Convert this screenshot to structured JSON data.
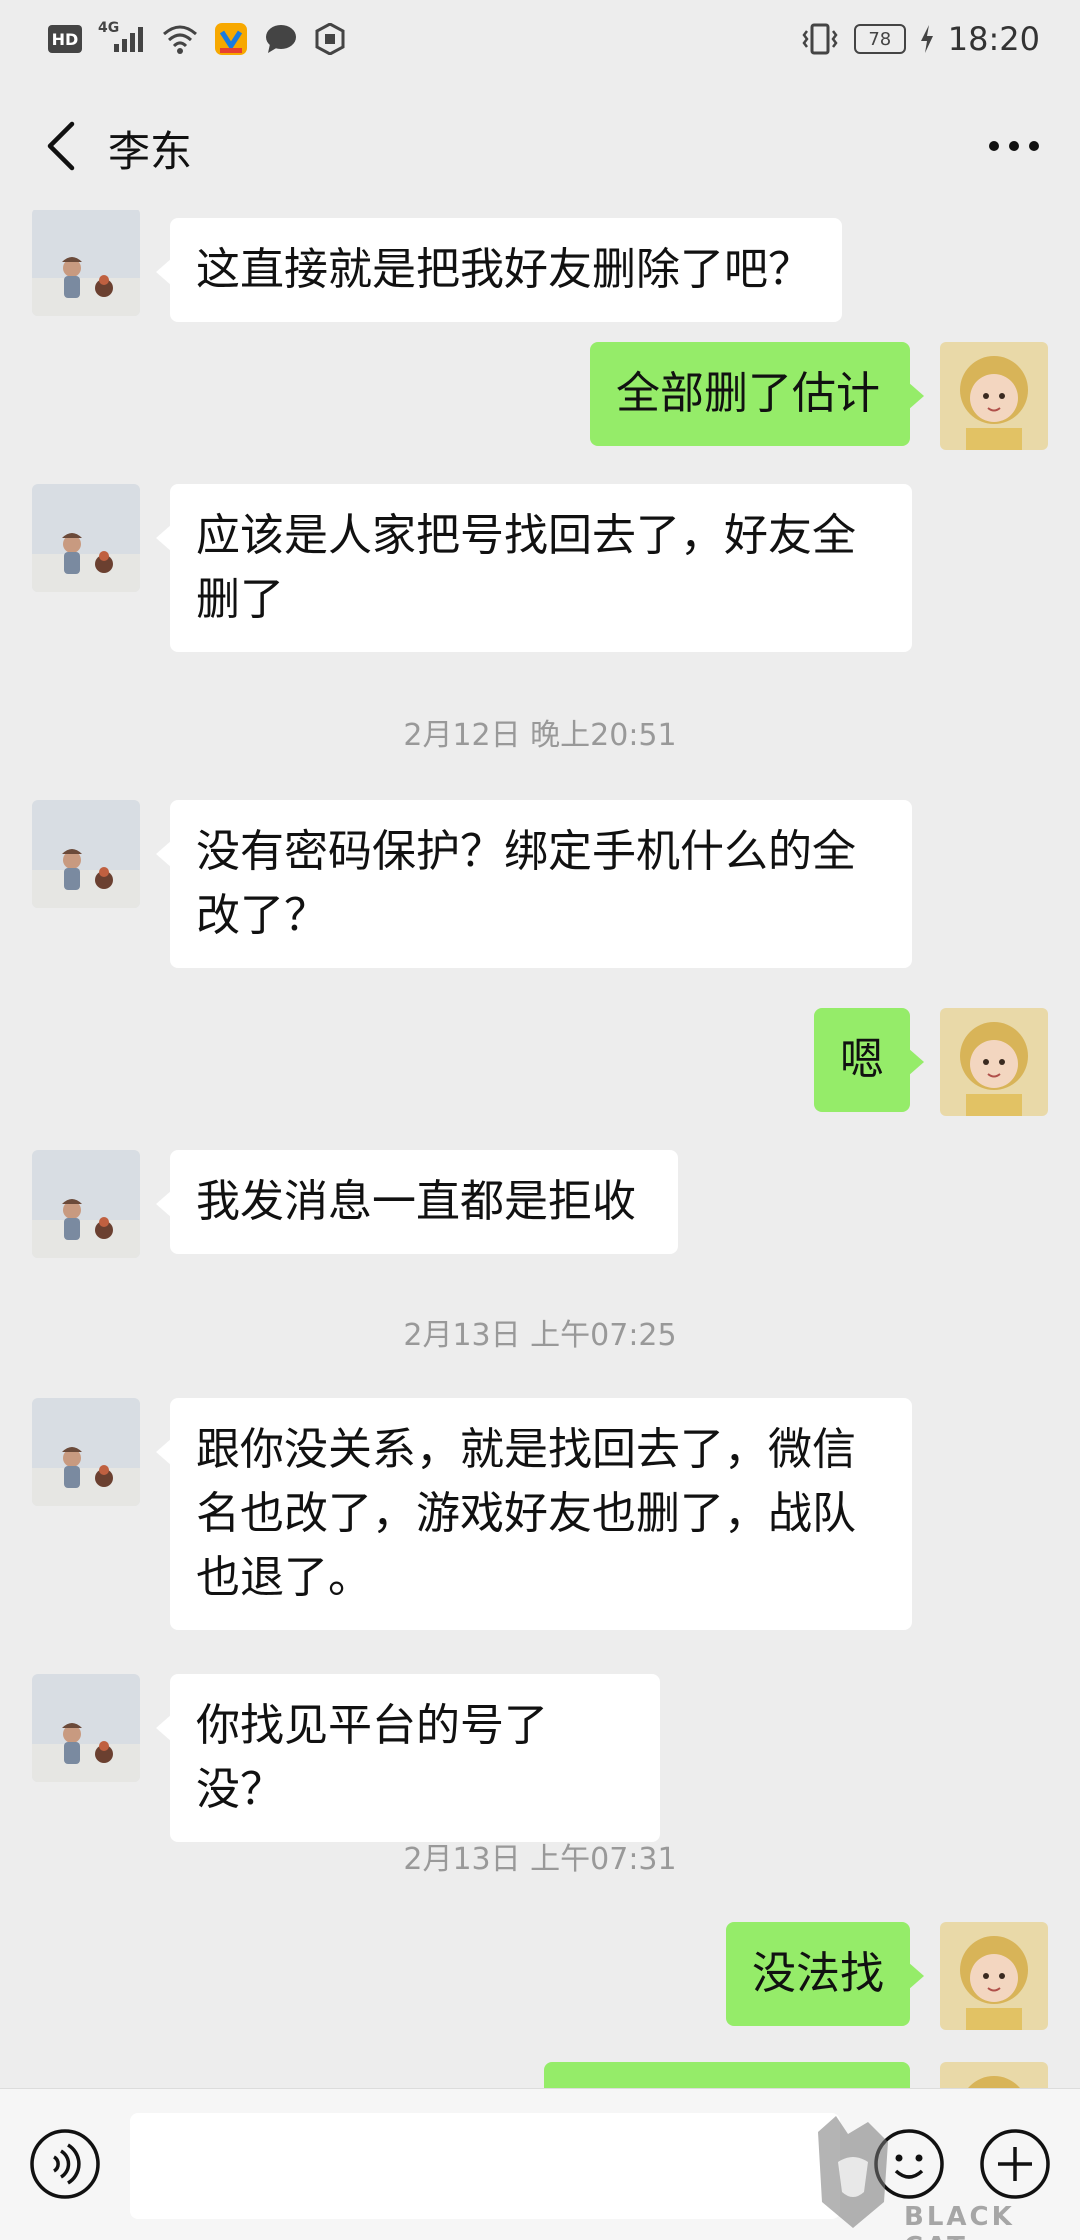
{
  "status_bar": {
    "hd": "HD",
    "network": "4G",
    "battery": "78",
    "time": "18:20"
  },
  "header": {
    "title": "李东"
  },
  "messages": [
    {
      "type": "msg",
      "side": "in",
      "text": "这直接就是把我好友删除了吧？"
    },
    {
      "type": "msg",
      "side": "out",
      "text": "全部删了估计"
    },
    {
      "type": "msg",
      "side": "in",
      "text": "应该是人家把号找回去了，好友全删了"
    },
    {
      "type": "time",
      "text": "2月12日 晚上20:51"
    },
    {
      "type": "msg",
      "side": "in",
      "text": "没有密码保护？绑定手机什么的全改了？"
    },
    {
      "type": "msg",
      "side": "out",
      "text": "嗯"
    },
    {
      "type": "msg",
      "side": "in",
      "text": "我发消息一直都是拒收"
    },
    {
      "type": "time",
      "text": "2月13日 上午07:25"
    },
    {
      "type": "msg",
      "side": "in",
      "text": "跟你没关系，就是找回去了，微信名也改了，游戏好友也删了，战队也退了。"
    },
    {
      "type": "msg",
      "side": "in",
      "text": "你找见平台的号了没？"
    },
    {
      "type": "time",
      "text": "2月13日 上午07:31"
    },
    {
      "type": "msg",
      "side": "out",
      "text": "没法找"
    }
  ],
  "input": {
    "value": "",
    "placeholder": ""
  },
  "watermark": {
    "text": "BLACK CAT"
  },
  "colors": {
    "background": "#ededed",
    "outgoing_bubble": "#95ec69",
    "incoming_bubble": "#ffffff"
  }
}
